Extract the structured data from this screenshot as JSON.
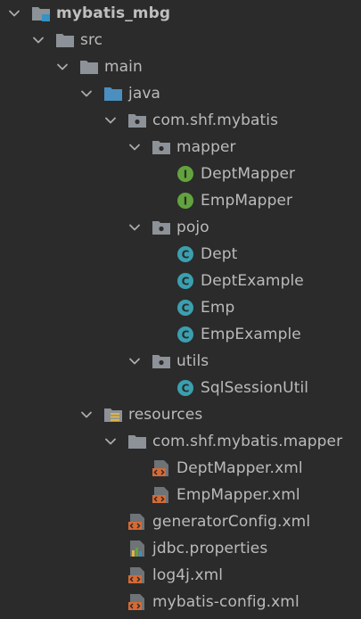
{
  "tree": {
    "nodes": [
      {
        "name": "mybatis_mbg",
        "type": "module-folder",
        "expanded": true,
        "depth": 0,
        "bold": true
      },
      {
        "name": "src",
        "type": "folder",
        "expanded": true,
        "depth": 1
      },
      {
        "name": "main",
        "type": "folder",
        "expanded": true,
        "depth": 2
      },
      {
        "name": "java",
        "type": "source-folder",
        "expanded": true,
        "depth": 3
      },
      {
        "name": "com.shf.mybatis",
        "type": "package",
        "expanded": true,
        "depth": 4
      },
      {
        "name": "mapper",
        "type": "package",
        "expanded": true,
        "depth": 5
      },
      {
        "name": "DeptMapper",
        "type": "interface",
        "depth": 6
      },
      {
        "name": "EmpMapper",
        "type": "interface",
        "depth": 6
      },
      {
        "name": "pojo",
        "type": "package",
        "expanded": true,
        "depth": 5
      },
      {
        "name": "Dept",
        "type": "class",
        "depth": 6
      },
      {
        "name": "DeptExample",
        "type": "class",
        "depth": 6
      },
      {
        "name": "Emp",
        "type": "class",
        "depth": 6
      },
      {
        "name": "EmpExample",
        "type": "class",
        "depth": 6
      },
      {
        "name": "utils",
        "type": "package",
        "expanded": true,
        "depth": 5
      },
      {
        "name": "SqlSessionUtil",
        "type": "class",
        "depth": 6
      },
      {
        "name": "resources",
        "type": "resources-folder",
        "expanded": true,
        "depth": 3
      },
      {
        "name": "com.shf.mybatis.mapper",
        "type": "folder",
        "expanded": true,
        "depth": 4
      },
      {
        "name": "DeptMapper.xml",
        "type": "xml",
        "depth": 5
      },
      {
        "name": "EmpMapper.xml",
        "type": "xml",
        "depth": 5
      },
      {
        "name": "generatorConfig.xml",
        "type": "xml",
        "depth": 4
      },
      {
        "name": "jdbc.properties",
        "type": "properties",
        "depth": 4
      },
      {
        "name": "log4j.xml",
        "type": "xml",
        "depth": 4
      },
      {
        "name": "mybatis-config.xml",
        "type": "xml",
        "depth": 4
      }
    ]
  },
  "colors": {
    "background": "#2b2b2b",
    "text": "#bbbbbb",
    "folder": "#8c9298",
    "source_folder": "#4a8fbf",
    "interface_icon": "#62a33e",
    "class_icon": "#3aa0b0",
    "xml_icon": "#d66a35",
    "arrow": "#a9acaf"
  }
}
